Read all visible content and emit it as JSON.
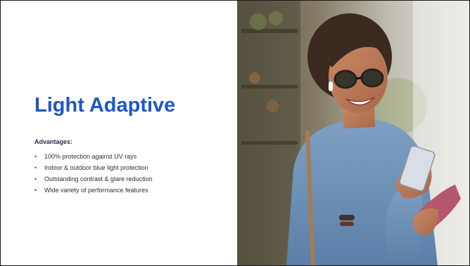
{
  "slide": {
    "title": "Light Adaptive",
    "advantages_heading": "Advantages:",
    "advantages": [
      "100% protection against UV rays",
      "Indoor & outdoor blue light protection",
      "Outstanding contrast & glare reduction",
      "Wide variety of performance features"
    ],
    "bullet_glyph": "•"
  },
  "colors": {
    "title": "#1f56c8",
    "bullet": "#1f56c8",
    "text": "#2a2f3a",
    "border": "#1a1a1a"
  },
  "image": {
    "subject": "photo-woman-smiling-wearing-light-adaptive-glasses-holding-phone"
  }
}
